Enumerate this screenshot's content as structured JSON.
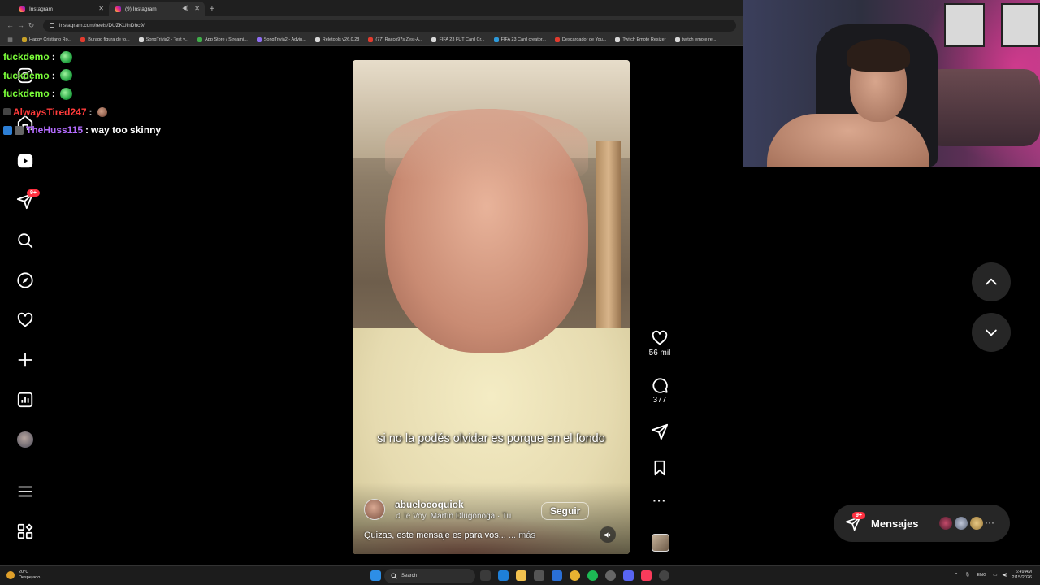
{
  "browser": {
    "tabs": [
      {
        "label": "Instagram",
        "active": false
      },
      {
        "label": "(9) Instagram",
        "active": true
      }
    ],
    "new_tab": "+",
    "url": "instagram.com/reels/DUZKUinDhc9/",
    "bookmarks": [
      {
        "label": "Happy Cristiano Ro...",
        "color": "#c9a227"
      },
      {
        "label": "Burago figura de to...",
        "color": "#e33b2e"
      },
      {
        "label": "SongTrivia2 - Test y...",
        "color": "#d9d9d9"
      },
      {
        "label": "App Store / Streami...",
        "color": "#3fae49"
      },
      {
        "label": "SongTrivia2 - Advin...",
        "color": "#8e6cf2"
      },
      {
        "label": "Reletools v26.0.28",
        "color": "#d9d9d9"
      },
      {
        "label": "(77) Racco97s Zest-A...",
        "color": "#e33b2e"
      },
      {
        "label": "FIFA 23 FUT Card Cr...",
        "color": "#d9d9d9"
      },
      {
        "label": "FIFA 23 Card creator...",
        "color": "#2d9adb"
      },
      {
        "label": "Descargador de You...",
        "color": "#e33b2e"
      },
      {
        "label": "Twitch Emote Resizer",
        "color": "#d9d9d9"
      },
      {
        "label": "twitch emote re...",
        "color": "#d9d9d9"
      }
    ]
  },
  "chat": [
    {
      "user": "fuckdemo",
      "sep": ":",
      "message": "",
      "color": "#7cff3a"
    },
    {
      "user": "fuckdemo",
      "sep": ":",
      "message": "",
      "color": "#7cff3a"
    },
    {
      "user": "fuckdemo",
      "sep": ":",
      "message": "",
      "color": "#7cff3a"
    },
    {
      "user": "AlwaysTired247",
      "sep": ":",
      "message": "",
      "color": "#ff3b3b"
    },
    {
      "user": "TheHuss115",
      "sep": ":",
      "message": "way too skinny",
      "color": "#b46cff"
    }
  ],
  "sidebar": {
    "notification_badge": "9+",
    "items": [
      "home-icon",
      "reels-icon",
      "messages-icon",
      "search-icon",
      "explore-icon",
      "notifications-icon",
      "create-icon",
      "dashboard-icon",
      "profile-avatar",
      "menu-icon",
      "apps-icon"
    ]
  },
  "reel": {
    "subtitle": "si no la podés olvidar es porque en el fondo",
    "author": "abuelocoquiok",
    "follow_label": "Seguir",
    "audio_prefix": "le Voy",
    "audio_artist": "Martín Dlugonoga · Tu",
    "caption": "Quizas, este mensaje es para vos...",
    "more_label": "... más"
  },
  "actions": {
    "likes": "56 mil",
    "comments": "377",
    "more": "···"
  },
  "messages_pill": {
    "badge": "9+",
    "label": "Mensajes",
    "more": "···"
  },
  "taskbar": {
    "weather_temp": "20°C",
    "weather_desc": "Despejado",
    "search_label": "Search",
    "lang": "ENG",
    "time": "6:49 AM",
    "date": "2/15/2026"
  },
  "colors": {
    "accent_red": "#ff3040",
    "ig_surface": "#262626",
    "chrome_bg": "#1f1f1f"
  }
}
